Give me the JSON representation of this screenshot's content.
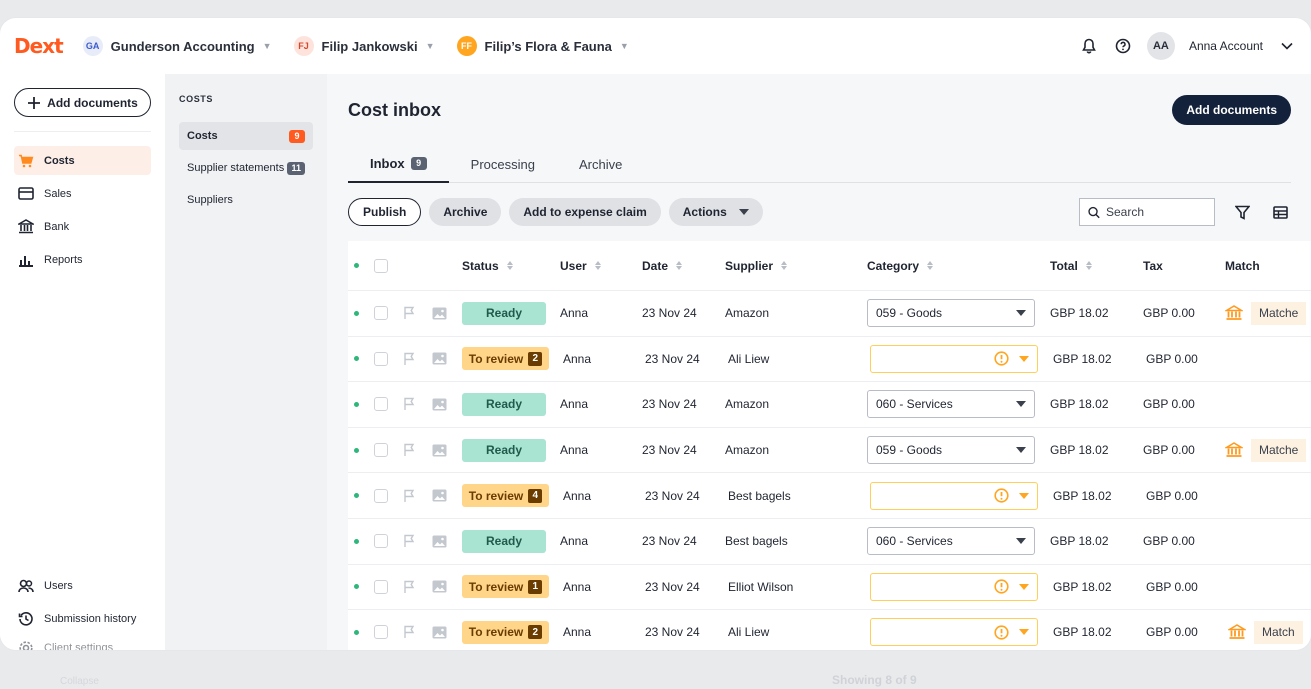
{
  "brand": {
    "logo": "Dext"
  },
  "breadcrumbs": [
    {
      "initials": "GA",
      "label": "Gunderson Accounting"
    },
    {
      "initials": "FJ",
      "label": "Filip Jankowski"
    },
    {
      "initials": "FF",
      "label": "Filip’s Flora & Fauna"
    }
  ],
  "account": {
    "initials": "AA",
    "name": "Anna Account"
  },
  "leftnav": {
    "add_documents": "Add documents",
    "items": [
      "Costs",
      "Sales",
      "Bank",
      "Reports"
    ],
    "bottom": [
      "Users",
      "Submission history",
      "Client settings"
    ]
  },
  "subnav": {
    "title": "COSTS",
    "items": [
      {
        "label": "Costs",
        "count": "9"
      },
      {
        "label": "Supplier statements",
        "count": "11"
      },
      {
        "label": "Suppliers",
        "count": ""
      }
    ]
  },
  "main": {
    "title": "Cost inbox",
    "add_documents": "Add documents",
    "tabs": [
      {
        "label": "Inbox",
        "count": "9"
      },
      {
        "label": "Processing",
        "count": ""
      },
      {
        "label": "Archive",
        "count": ""
      }
    ],
    "actions": {
      "publish": "Publish",
      "archive": "Archive",
      "expense": "Add to expense claim",
      "actions": "Actions"
    },
    "search_placeholder": "Search",
    "columns": {
      "status": "Status",
      "user": "User",
      "date": "Date",
      "supplier": "Supplier",
      "category": "Category",
      "total": "Total",
      "tax": "Tax",
      "match": "Match"
    },
    "rows": [
      {
        "status": "Ready",
        "review": "",
        "user": "Anna",
        "date": "23 Nov 24",
        "supplier": "Amazon",
        "category": "059 - Goods",
        "total": "GBP 18.02",
        "tax": "GBP 0.00",
        "match": "Matche"
      },
      {
        "status": "To review",
        "review": "2",
        "user": "Anna",
        "date": "23 Nov 24",
        "supplier": "Ali Liew",
        "category": "",
        "total": "GBP 18.02",
        "tax": "GBP 0.00",
        "match": ""
      },
      {
        "status": "Ready",
        "review": "",
        "user": "Anna",
        "date": "23 Nov 24",
        "supplier": "Amazon",
        "category": "060 - Services",
        "total": "GBP 18.02",
        "tax": "GBP 0.00",
        "match": ""
      },
      {
        "status": "Ready",
        "review": "",
        "user": "Anna",
        "date": "23 Nov 24",
        "supplier": "Amazon",
        "category": "059 - Goods",
        "total": "GBP 18.02",
        "tax": "GBP 0.00",
        "match": "Matche"
      },
      {
        "status": "To review",
        "review": "4",
        "user": "Anna",
        "date": "23 Nov 24",
        "supplier": "Best bagels",
        "category": "",
        "total": "GBP 18.02",
        "tax": "GBP 0.00",
        "match": ""
      },
      {
        "status": "Ready",
        "review": "",
        "user": "Anna",
        "date": "23 Nov 24",
        "supplier": "Best bagels",
        "category": "060 - Services",
        "total": "GBP 18.02",
        "tax": "GBP 0.00",
        "match": ""
      },
      {
        "status": "To review",
        "review": "1",
        "user": "Anna",
        "date": "23 Nov 24",
        "supplier": "Elliot Wilson",
        "category": "",
        "total": "GBP 18.02",
        "tax": "GBP 0.00",
        "match": ""
      },
      {
        "status": "To review",
        "review": "2",
        "user": "Anna",
        "date": "23 Nov 24",
        "supplier": "Ali Liew",
        "category": "",
        "total": "GBP 18.02",
        "tax": "GBP 0.00",
        "match": "Match"
      }
    ],
    "footer": "Showing 8 of 9",
    "collapse": "Collapse"
  },
  "colors": {
    "brand": "#ff5a1f",
    "ready": "#a9e4d3",
    "review": "#ffd58a",
    "dark": "#13213b"
  }
}
